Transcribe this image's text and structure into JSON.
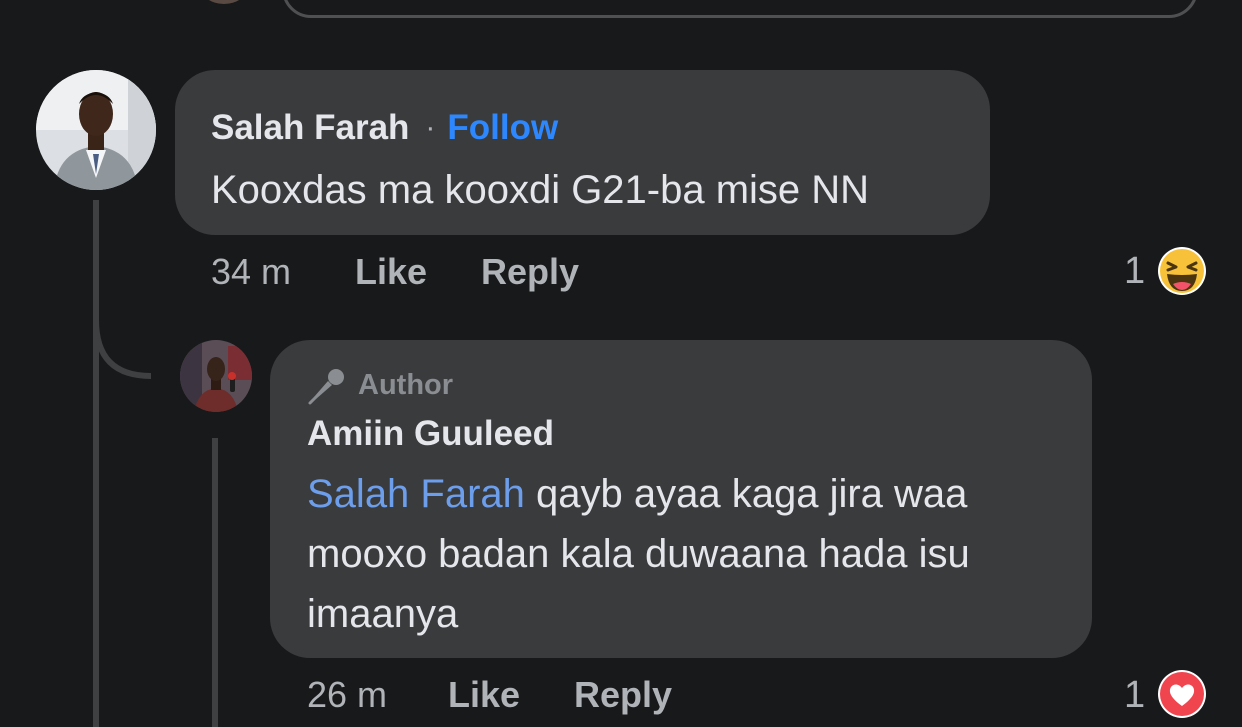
{
  "comment": {
    "author": "Salah Farah",
    "separator": "·",
    "follow_label": "Follow",
    "text": "Kooxdas ma kooxdi G21-ba mise NN",
    "time": "34 m",
    "like_label": "Like",
    "reply_label": "Reply",
    "reaction_count": "1",
    "reaction_icon": "haha-emoji-icon"
  },
  "reply": {
    "badge_label": "Author",
    "badge_icon": "microphone-icon",
    "author": "Amiin Guuleed",
    "mention": "Salah Farah",
    "text_line1": " qayb ayaa kaga jira waa",
    "text_line2": "mooxo badan kala duwaana hada isu",
    "text_line3": "imaanya",
    "time": "26 m",
    "like_label": "Like",
    "reply_label": "Reply",
    "reaction_count": "1",
    "reaction_icon": "love-heart-icon"
  },
  "colors": {
    "background": "#18191a",
    "bubble": "#3a3b3c",
    "follow": "#2d88ff",
    "mention": "#6d9eeb",
    "secondary_text": "#b0b3b8"
  }
}
